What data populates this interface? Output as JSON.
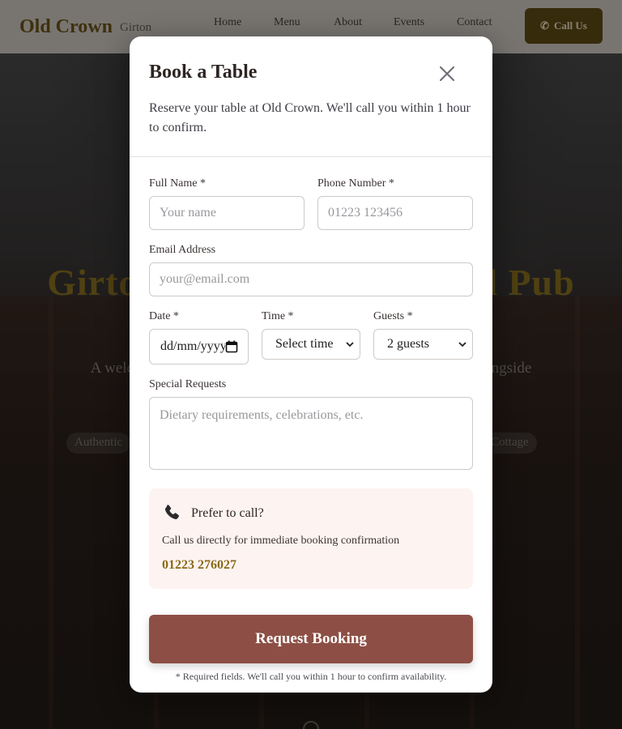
{
  "nav": {
    "logo": "Old Crown",
    "logo_sub": "Girton",
    "links": [
      "Home",
      "Menu",
      "About",
      "Events",
      "Contact"
    ],
    "cta": "Call Us"
  },
  "hero": {
    "title": "Girton's Historic Thatched Pub",
    "subtitle": "A welcoming village pub with traditional ales and fine dining alongside",
    "chips": [
      "Authentic",
      "Cottage"
    ]
  },
  "modal": {
    "title": "Book a Table",
    "description": "Reserve your table at Old Crown. We'll call you within 1 hour to confirm.",
    "fields": {
      "full_name": {
        "label": "Full Name *",
        "placeholder": "Your name"
      },
      "phone": {
        "label": "Phone Number *",
        "placeholder": "01223 123456"
      },
      "email": {
        "label": "Email Address",
        "placeholder": "your@email.com"
      },
      "date": {
        "label": "Date *",
        "value": "dd/mm/yyyy"
      },
      "time": {
        "label": "Time *",
        "value": "Select time"
      },
      "guests": {
        "label": "Guests *",
        "value": "2 guests"
      },
      "requests": {
        "label": "Special Requests",
        "placeholder": "Dietary requirements, celebrations, etc."
      }
    },
    "call_box": {
      "title": "Prefer to call?",
      "text": "Call us directly for immediate booking confirmation",
      "phone": "01223 276027"
    },
    "submit_label": "Request Booking",
    "footnote": "* Required fields. We'll call you within 1 hour to confirm availability."
  },
  "colors": {
    "accent_button": "#8d4f45",
    "phone_number": "#8a6a16",
    "call_box_bg": "#fdf3f1",
    "logo_gold": "#6b5418"
  },
  "icons": [
    "close-icon",
    "phone-icon",
    "calendar-icon",
    "chevron-down-icon"
  ]
}
